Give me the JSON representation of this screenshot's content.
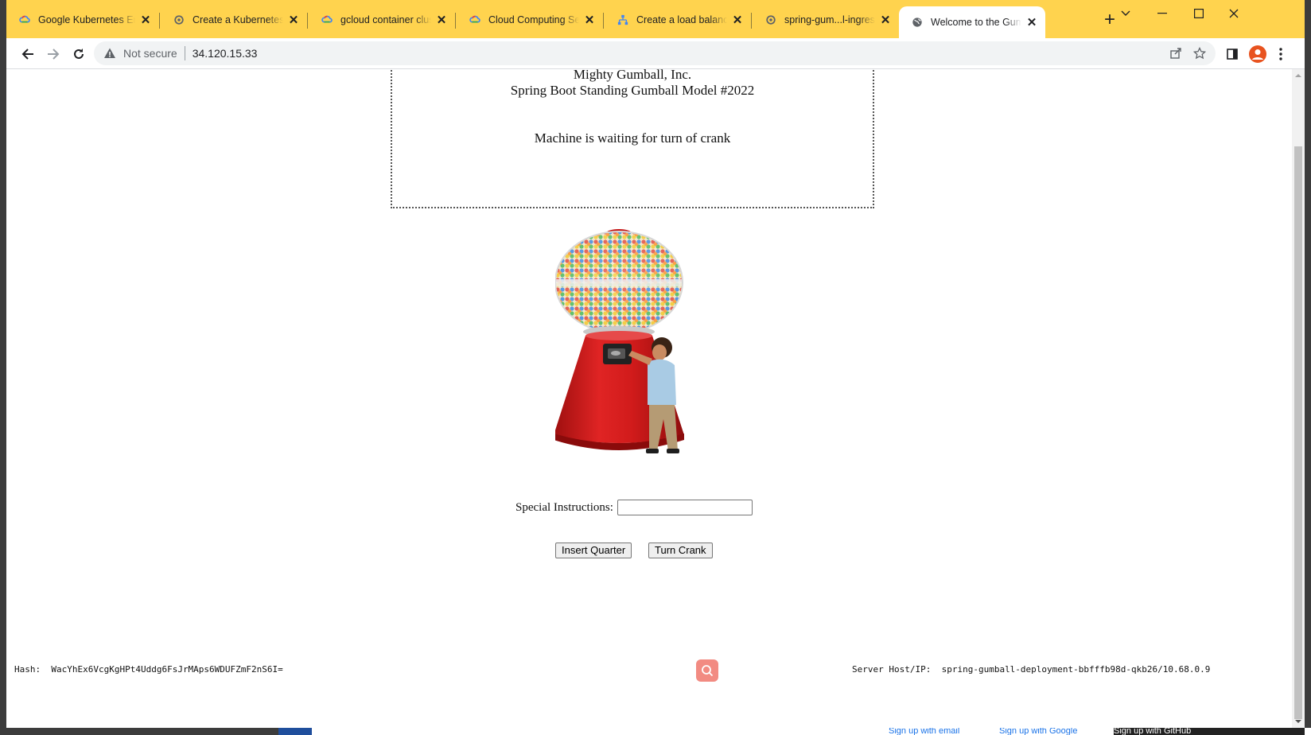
{
  "browser": {
    "tabs": [
      {
        "title": "Google Kubernetes Engi",
        "icon": "google-cloud-icon"
      },
      {
        "title": "Create a Kubernetes clus",
        "icon": "gear-icon"
      },
      {
        "title": "gcloud container cluster",
        "icon": "google-cloud-icon"
      },
      {
        "title": "Cloud Computing Servic",
        "icon": "google-cloud-icon"
      },
      {
        "title": "Create a load balancer -",
        "icon": "load-balancer-icon"
      },
      {
        "title": "spring-gum...l-ingress -",
        "icon": "gear-icon"
      },
      {
        "title": "Welcome to the Gumbal",
        "icon": "globe-icon",
        "active": true
      }
    ],
    "security_label": "Not secure",
    "url": "34.120.15.33"
  },
  "page": {
    "company": "Mighty Gumball, Inc.",
    "model": "Spring Boot Standing Gumball Model #2022",
    "status": "Machine is waiting for turn of crank",
    "instructions_label": "Special Instructions:",
    "instructions_value": "",
    "insert_quarter": "Insert Quarter",
    "turn_crank": "Turn Crank",
    "hash_label": "Hash:",
    "hash_value": "WacYhEx6VcgKgHPt4Uddg6FsJrMAps6WDUFZmF2nS6I=",
    "server_label": "Server Host/IP:",
    "server_value": "spring-gumball-deployment-bbfffb98d-qkb26/10.68.0.9"
  },
  "background_window": {
    "links": [
      "Sign up with email",
      "Sign up with Google",
      "Sign up with GitHub"
    ]
  },
  "colors": {
    "tabstrip": "#ffd34e",
    "machine_red": "#d61f1f",
    "search_button": "#f28b82"
  }
}
